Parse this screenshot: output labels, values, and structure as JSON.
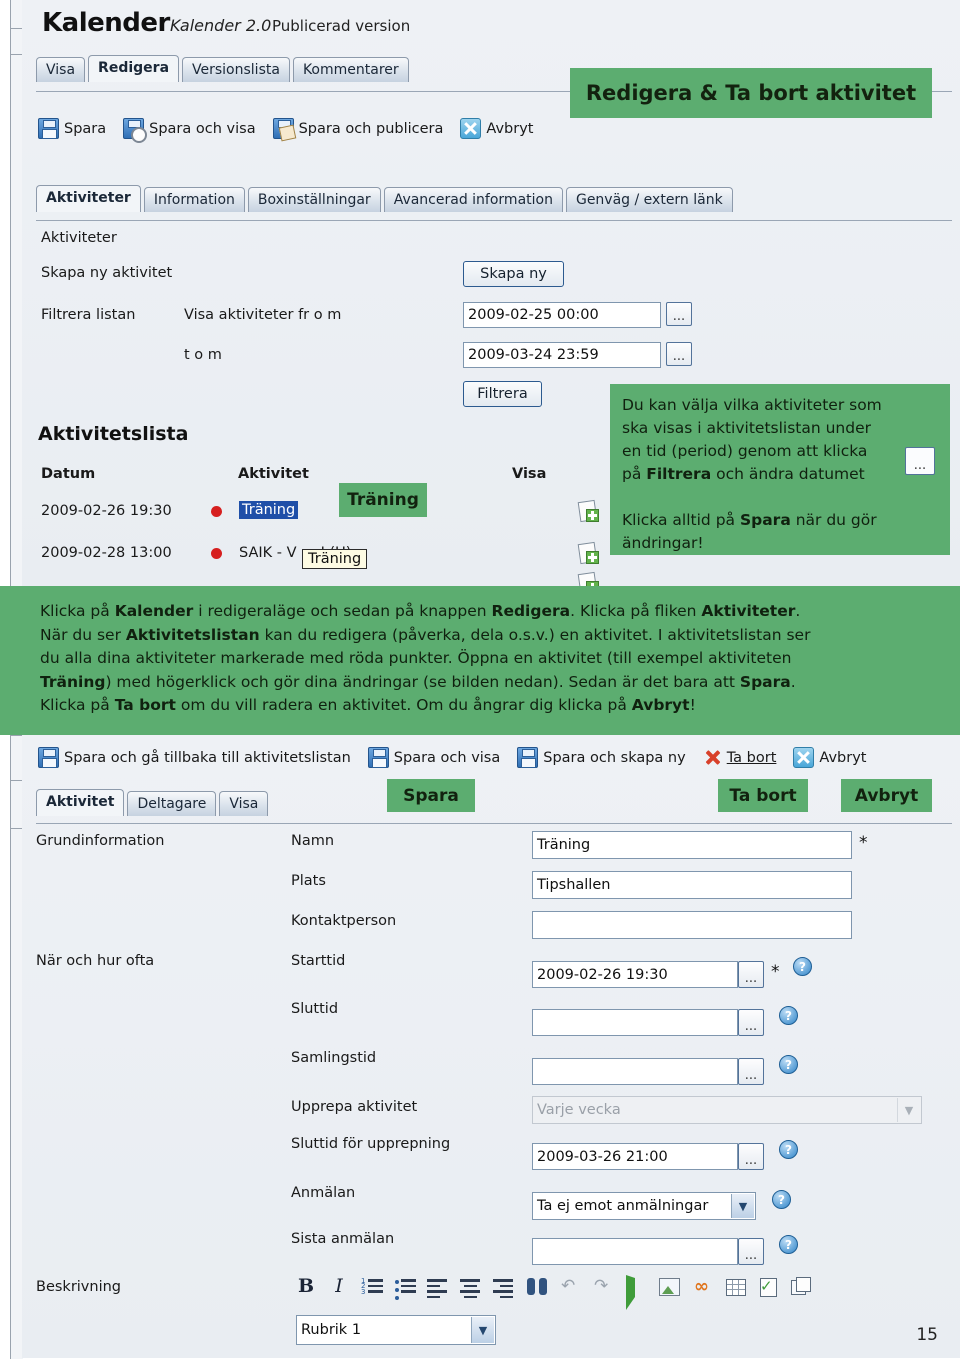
{
  "app": {
    "title": "Kalender",
    "version": "Kalender 2.0",
    "published": "Publicerad version"
  },
  "top_tabs": [
    {
      "label": "Visa",
      "active": false
    },
    {
      "label": "Redigera",
      "active": true
    },
    {
      "label": "Versionslista",
      "active": false
    },
    {
      "label": "Kommentarer",
      "active": false
    }
  ],
  "top_toolbar": [
    {
      "label": "Spara",
      "icon": "floppy-icon"
    },
    {
      "label": "Spara och visa",
      "icon": "floppy-view-icon"
    },
    {
      "label": "Spara och publicera",
      "icon": "floppy-publish-icon"
    },
    {
      "label": "Avbryt",
      "icon": "cancel-icon"
    }
  ],
  "section_tabs": [
    {
      "label": "Aktiviteter",
      "active": true
    },
    {
      "label": "Information",
      "active": false
    },
    {
      "label": "Boxinställningar",
      "active": false
    },
    {
      "label": "Avancerad information",
      "active": false
    },
    {
      "label": "Genväg / extern länk",
      "active": false
    }
  ],
  "activities_panel": {
    "heading": "Aktiviteter",
    "create_label": "Skapa ny aktivitet",
    "create_button": "Skapa ny",
    "filter_label": "Filtrera listan",
    "from_label": "Visa aktiviteter fr o m",
    "from_value": "2009-02-25 00:00",
    "to_label": "t o m",
    "to_value": "2009-03-24 23:59",
    "filter_button": "Filtrera",
    "dots_button": "..."
  },
  "activity_list": {
    "heading": "Aktivitetslista",
    "columns": [
      "Datum",
      "Aktivitet",
      "Visa"
    ],
    "rows": [
      {
        "datum": "2009-02-26 19:30",
        "aktivitet": "Träning",
        "selected": true
      },
      {
        "datum": "2009-02-28 13:00",
        "aktivitet": "SAIK - V       ra J (U)",
        "selected": false
      }
    ],
    "tooltip": "Träning",
    "highlight_tag": "Träning"
  },
  "callouts": {
    "title": "Redigera & Ta bort aktivitet",
    "note_line1": "Du kan välja vilka aktiviteter som",
    "note_line2": "ska visas i aktivitetslistan under",
    "note_line3a": "en tid (period) genom att klicka",
    "note_line4a": "på ",
    "note_line4b": "Filtrera",
    "note_line4c": " och ändra datumet",
    "note_line5a": "Klicka alltid på ",
    "note_line5b": "Spara",
    "note_line5c": " när du gör",
    "note_line6": "ändringar!",
    "note_dots": "...",
    "tag_spara": "Spara",
    "tag_tabort": "Ta bort",
    "tag_avbryt": "Avbryt"
  },
  "green_band": {
    "p1a": "Klicka på ",
    "p1b": "Kalender",
    "p1c": " i redigeraläge och sedan på knappen ",
    "p1d": "Redigera",
    "p1e": ". Klicka på fliken ",
    "p1f": "Aktiviteter",
    "p1g": ".",
    "p2a": "När du ser ",
    "p2b": "Aktivitetslistan",
    "p2c": " kan du redigera (påverka, dela o.s.v.) en aktivitet. I aktivitetslistan ser",
    "p3": "du alla dina aktiviteter markerade med röda punkter. Öppna en aktivitet (till exempel aktiviteten",
    "p4a": "Träning",
    "p4b": ") med högerklick och gör dina ändringar (se bilden nedan). Sedan är det bara att ",
    "p4c": "Spara",
    "p4d": ".",
    "p5a": "Klicka på ",
    "p5b": "Ta bort",
    "p5c": " om du vill radera en aktivitet. Om du ångrar dig klicka på ",
    "p5d": "Avbryt",
    "p5e": "!"
  },
  "bottom_toolbar": [
    {
      "label": "Spara och gå tillbaka till aktivitetslistan",
      "icon": "floppy-icon"
    },
    {
      "label": "Spara och visa",
      "icon": "floppy-icon"
    },
    {
      "label": "Spara och skapa ny",
      "icon": "floppy-icon"
    },
    {
      "label": "Ta bort",
      "icon": "delete-icon"
    },
    {
      "label": "Avbryt",
      "icon": "cancel-icon"
    }
  ],
  "bottom_tabs": [
    {
      "label": "Aktivitet",
      "active": true
    },
    {
      "label": "Deltagare",
      "active": false
    },
    {
      "label": "Visa",
      "active": false
    }
  ],
  "form": {
    "group1": "Grundinformation",
    "group2": "När och hur ofta",
    "group3": "Beskrivning",
    "fields": [
      {
        "label": "Namn",
        "value": "Träning",
        "required": true,
        "type": "text"
      },
      {
        "label": "Plats",
        "value": "Tipshallen",
        "required": false,
        "type": "text"
      },
      {
        "label": "Kontaktperson",
        "value": "",
        "required": false,
        "type": "text"
      },
      {
        "label": "Starttid",
        "value": "2009-02-26 19:30",
        "required": true,
        "type": "datetime"
      },
      {
        "label": "Sluttid",
        "value": "",
        "required": false,
        "type": "datetime"
      },
      {
        "label": "Samlingstid",
        "value": "",
        "required": false,
        "type": "datetime"
      },
      {
        "label": "Upprepa aktivitet",
        "value": "Varje vecka",
        "required": false,
        "type": "select-disabled"
      },
      {
        "label": "Sluttid för upprepning",
        "value": "2009-03-26 21:00",
        "required": false,
        "type": "datetime"
      },
      {
        "label": "Anmälan",
        "value": "Ta ej emot anmälningar",
        "required": false,
        "type": "select"
      },
      {
        "label": "Sista anmälan",
        "value": "",
        "required": false,
        "type": "datetime"
      }
    ],
    "dots_button": "...",
    "help_button": "?",
    "required_mark": "*",
    "style_select": "Rubrik 1"
  },
  "editor_icons": [
    "bold-icon",
    "italic-icon",
    "ordered-list-icon",
    "bullet-list-icon",
    "align-left-icon",
    "align-center-icon",
    "align-right-icon",
    "find-icon",
    "undo-icon",
    "redo-icon",
    "cursor-icon",
    "image-icon",
    "link-icon",
    "table-icon",
    "validate-icon",
    "copy-icon"
  ],
  "page_number": "15",
  "colors": {
    "green": "#5cad70",
    "red_dot": "#d61f1f",
    "selection_blue": "#1f4fa8",
    "tooltip_bg": "#fdfbe3"
  }
}
